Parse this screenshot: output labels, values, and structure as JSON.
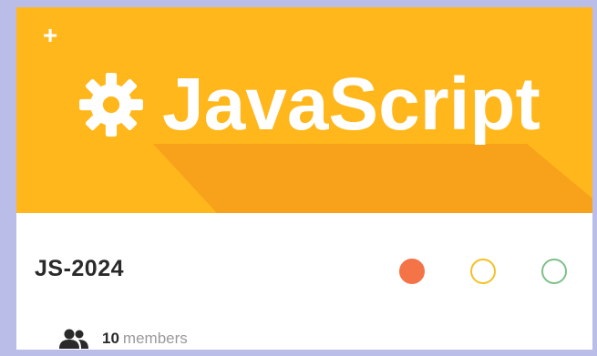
{
  "header": {
    "add_icon": "plus-icon",
    "logo_icon": "gear-icon",
    "title": "JavaScript",
    "background_color": "#ffb71b",
    "shadow_color": "#f79e1b"
  },
  "card": {
    "code": "JS-2024",
    "status_dots": [
      {
        "color": "#f47347",
        "filled": true
      },
      {
        "color": "#f5c026",
        "filled": false
      },
      {
        "color": "#7fbf8a",
        "filled": false
      }
    ],
    "members": {
      "icon": "people-icon",
      "count": "10",
      "label": "members"
    }
  }
}
